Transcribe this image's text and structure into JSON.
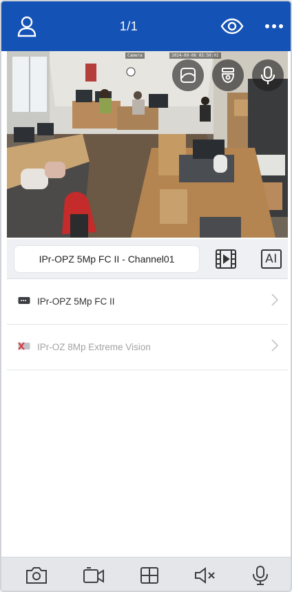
{
  "header": {
    "page_indicator": "1/1"
  },
  "video": {
    "osd_camera": "Camera",
    "osd_timestamp": "2024-09-06 05:50:02"
  },
  "channel": {
    "selected": "IPr-OPZ 5Mp FC II - Channel01",
    "ai_label": "AI"
  },
  "devices": [
    {
      "name": "IPr-OPZ 5Mp FC II",
      "status": "online"
    },
    {
      "name": "IPr-OZ 8Mp Extreme Vision",
      "status": "offline"
    }
  ],
  "colors": {
    "header_bg": "#1452b5",
    "offline_icon": "#d9343a",
    "toolbar_bg": "#e4e6ea"
  },
  "icons": {
    "header": [
      "user-icon",
      "eye-icon",
      "more-icon"
    ],
    "overlay": [
      "fisheye-view-icon",
      "ptz-dome-icon",
      "microphone-icon"
    ],
    "channel": [
      "playback-film-icon",
      "ai-icon"
    ],
    "toolbar": [
      "snapshot-camera-icon",
      "record-video-icon",
      "grid-layout-icon",
      "speaker-muted-icon",
      "talk-microphone-icon"
    ]
  }
}
